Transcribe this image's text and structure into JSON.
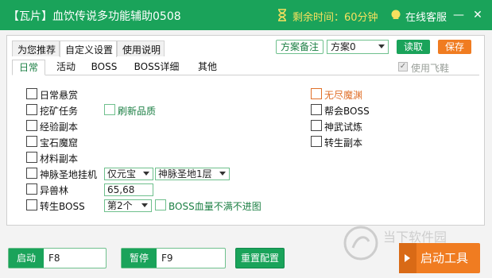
{
  "window": {
    "title": "【瓦片】血饮传说多功能辅助0508",
    "timer_text": "剩余时间：60分钟",
    "support_text": "在线客服",
    "minimize_glyph": "—",
    "close_glyph": "✕"
  },
  "top_tabs": [
    "为您推荐",
    "自定义设置",
    "使用说明"
  ],
  "toolbar": {
    "note_button": "方案备注",
    "scheme_value": "方案0",
    "load_button": "读取",
    "save_button": "保存"
  },
  "sub_tabs": [
    "日常",
    "活动",
    "BOSS",
    "BOSS详细",
    "其他"
  ],
  "fly_shoes": {
    "label": "使用飞鞋",
    "checked": true,
    "check_glyph": "✓"
  },
  "left_items": {
    "daily_bounty": "日常悬赏",
    "mining_task": "挖矿任务",
    "refresh_quality": "刷新品质",
    "exp_dungeon": "经验副本",
    "gem_cave": "宝石魔窟",
    "material_dungeon": "材料副本",
    "sacred_land": "神脉圣地挂机",
    "sacred_land_mode": "仅元宝",
    "sacred_land_floor": "神脉圣地1层",
    "beast_forest": "异兽林",
    "beast_forest_coords": "65,68",
    "rebirth_boss": "转生BOSS",
    "rebirth_boss_which": "第2个",
    "boss_hp_skip": "BOSS血量不满不进图"
  },
  "right_items": {
    "endless_abyss": "无尽魔渊",
    "guild_boss": "帮会BOSS",
    "divine_trial": "神武试炼",
    "rebirth_dungeon": "转生副本"
  },
  "bottom": {
    "start_label": "启动",
    "start_key": "F8",
    "pause_label": "暂停",
    "pause_key": "F9",
    "reset_button": "重置配置",
    "start_tool_button": "启动工具"
  },
  "watermark": {
    "line1": "当下软件园"
  },
  "colors": {
    "primary_green": "#1aa35a",
    "accent_orange": "#f07c21",
    "timer_yellow": "#f6e05e"
  }
}
